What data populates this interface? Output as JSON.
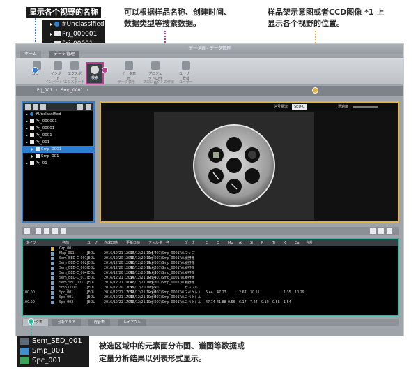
{
  "callouts": {
    "tree_label": "显示各个视野的名称",
    "search_line1": "可以根据样品名称、创建时间、",
    "search_line2": "数据类型等搜索数据。",
    "holder_line1": "样品架示意图或者CCD图像 *1 上",
    "holder_line2": "显示各个视野的位置。",
    "list_line1": "被选区域中的元素面分布图、谱图等数据或",
    "list_line2": "定量分析结果以列表形式显示。"
  },
  "inset_tree": [
    "#Unclassified",
    "Prj_000001",
    "Prj_00001"
  ],
  "inset_data": [
    "Sem_SED_001",
    "Smp_001",
    "Spc_001"
  ],
  "colors": {
    "tree_accent": "#2f7fd0",
    "search_accent": "#c03a92",
    "viewer_accent": "#e7b23a",
    "list_accent": "#2fb7a0"
  },
  "app": {
    "title": "データ表 - データ管理",
    "ribbon_tabs": [
      "ホーム",
      "データ管理"
    ],
    "ribbon_buttons": [
      "コピー",
      "インポート",
      "エクスポート",
      "検索",
      "データ表示",
      "プロジェクトの作成",
      "ユーザー登録"
    ],
    "group_labels": [
      "インポート/エクスポート",
      "データ表示",
      "プロジェクトの作成",
      "ユーザー"
    ],
    "breadcrumb": [
      "Prj_001",
      "Smp_0001"
    ],
    "tree_items": [
      {
        "label": "#Unclassified",
        "level": 0
      },
      {
        "label": "Prj_000001",
        "level": 0
      },
      {
        "label": "Prj_00001",
        "level": 0
      },
      {
        "label": "Prj_0001",
        "level": 0
      },
      {
        "label": "Prj_001",
        "level": 0
      },
      {
        "label": "Smp_0001",
        "level": 1,
        "selected": true
      },
      {
        "label": "Smp_001",
        "level": 1
      },
      {
        "label": "Prj_01",
        "level": 0
      }
    ],
    "viewer_signal": "信号電流",
    "viewer_detector": "SED-C",
    "viewer_brightness": "透過度",
    "list_headers": [
      "タイプ",
      "名前",
      "ユーザー",
      "作成日時",
      "更新日時",
      "フォルダー名",
      "データ",
      "C",
      "O",
      "Mg",
      "Al",
      "Si",
      "P",
      "Ti",
      "K",
      "Ca",
      "合計"
    ],
    "list_rows": [
      {
        "name": "Grp_001",
        "user": "",
        "created": "",
        "updated": "",
        "folder": "",
        "data": "",
        "vals": []
      },
      {
        "name": "Map_001",
        "user": "JEOL",
        "created": "2016/12/21 11:57",
        "updated": "2016/12/21 11:57",
        "folder": "Prj_001\\Smp_0001\\Vi...",
        "data": "マップ",
        "vals": []
      },
      {
        "name": "Sem_BED-C_001",
        "user": "JEOL",
        "created": "2016/12/20 11:41",
        "updated": "2016/12/20 11:41",
        "folder": "Prj_001\\Smp_0001\\Vi...",
        "data": "視野像",
        "vals": []
      },
      {
        "name": "Sem_BED-C_002",
        "user": "JEOL",
        "created": "2016/12/20 11:41",
        "updated": "2016/12/20 11:41",
        "folder": "Prj_001\\Smp_0001\\Vi...",
        "data": "視野像",
        "vals": []
      },
      {
        "name": "Sem_BED-C_003",
        "user": "JEOL",
        "created": "2016/12/20 11:42",
        "updated": "2016/12/20 11:42",
        "folder": "Prj_001\\Smp_0001\\Vi...",
        "data": "視野像",
        "vals": []
      },
      {
        "name": "Sem_BED-C_004",
        "user": "JEOL",
        "created": "2016/12/20 11:43",
        "updated": "2016/12/20 11:43",
        "folder": "Prj_001\\Smp_0001\\Vi...",
        "data": "視野像",
        "vals": []
      },
      {
        "name": "Sem_BED-C_017",
        "user": "JEOL",
        "created": "2016/12/21 17:34",
        "updated": "2016/12/21 17:34",
        "folder": "Prj_001\\Smp_0001\\Vi...",
        "data": "視野像",
        "vals": []
      },
      {
        "name": "Sem_SED_001",
        "user": "JEOL",
        "created": "2016/12/21 16:47",
        "updated": "2016/12/21 16:47",
        "folder": "Prj_001\\Smp_0001\\Vi...",
        "data": "視野像",
        "vals": []
      },
      {
        "name": "Smp_0001",
        "user": "JEOL",
        "created": "2016/12/20 13:35",
        "updated": "2016/12/20 13:35",
        "folder": "Prj_001",
        "data": "サンプル",
        "vals": []
      },
      {
        "name": "Spc_001",
        "user": "JEOL",
        "created": "2016/12/21 17:39",
        "updated": "2016/12/21 17:40",
        "folder": "Prj_001\\Smp_0001\\Vi...",
        "data": "スペクトル",
        "vals": [
          "6.44",
          "47.23",
          "",
          "2.67",
          "30.11",
          "",
          "",
          "1.35",
          "10.29",
          "",
          "100.00"
        ]
      },
      {
        "name": "Spc_001",
        "user": "JEOL",
        "created": "2016/12/21 17:39",
        "updated": "2016/12/21 17:40",
        "folder": "Prj_001\\Smp_0001\\Vi...",
        "data": "スペクトル",
        "vals": []
      },
      {
        "name": "Spc_002",
        "user": "JEOL",
        "created": "2016/12/21 17:41",
        "updated": "2016/12/21 17:41",
        "folder": "Prj_001\\Smp_0001\\Vi...",
        "data": "スペクトル",
        "vals": [
          "47.74",
          "41.88",
          "0.56",
          "6.17",
          "7.24",
          "0.19",
          "0.58",
          "1.54",
          "",
          "",
          "100.00"
        ]
      }
    ],
    "bottom_tabs": [
      "データ表",
      "分析エリア",
      "総合表",
      "レイアウト"
    ]
  }
}
